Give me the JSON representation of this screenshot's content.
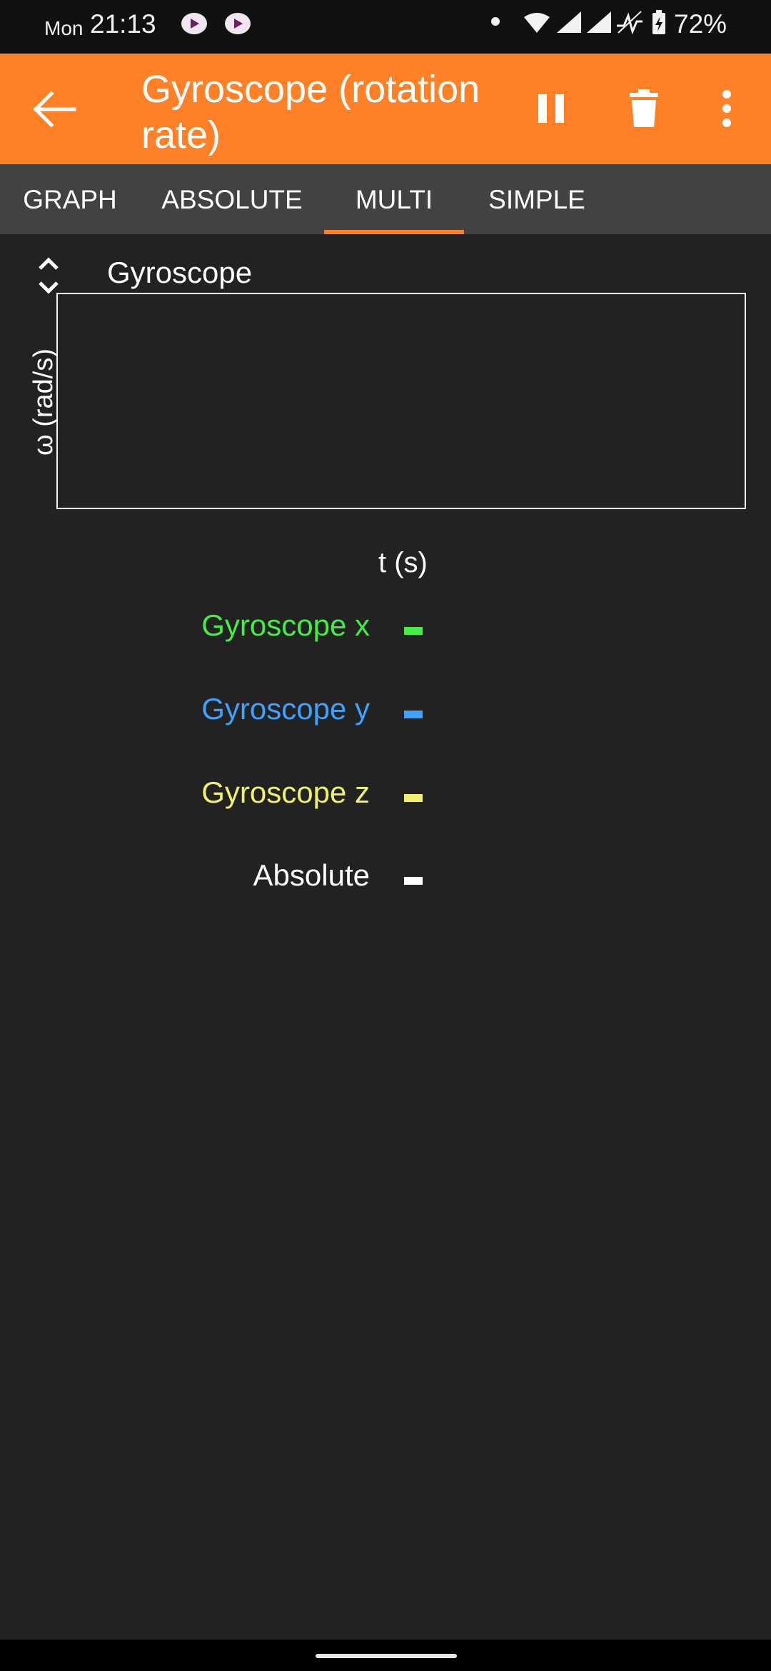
{
  "status_bar": {
    "day": "Mon",
    "time": "21:13",
    "battery": "72%"
  },
  "app_bar": {
    "title": "Gyroscope (rotation rate)",
    "background_color": "#ff8127"
  },
  "tabs": [
    {
      "label": "GRAPH",
      "active": false
    },
    {
      "label": "ABSOLUTE",
      "active": false
    },
    {
      "label": "MULTI",
      "active": true
    },
    {
      "label": "SIMPLE",
      "active": false
    }
  ],
  "graph": {
    "title": "Gyroscope",
    "ylabel": "ω (rad/s)",
    "xlabel": "t (s)"
  },
  "legend": [
    {
      "label": "Gyroscope x",
      "color": "#44ee44"
    },
    {
      "label": "Gyroscope y",
      "color": "#3fa2ff"
    },
    {
      "label": "Gyroscope z",
      "color": "#f0f06e"
    },
    {
      "label": "Absolute",
      "color": "#ffffff"
    }
  ],
  "icons": {
    "back": "arrow-left-icon",
    "pause": "pause-icon",
    "delete": "trash-icon",
    "more": "more-vert-icon",
    "expand": "expand-collapse-icon"
  }
}
